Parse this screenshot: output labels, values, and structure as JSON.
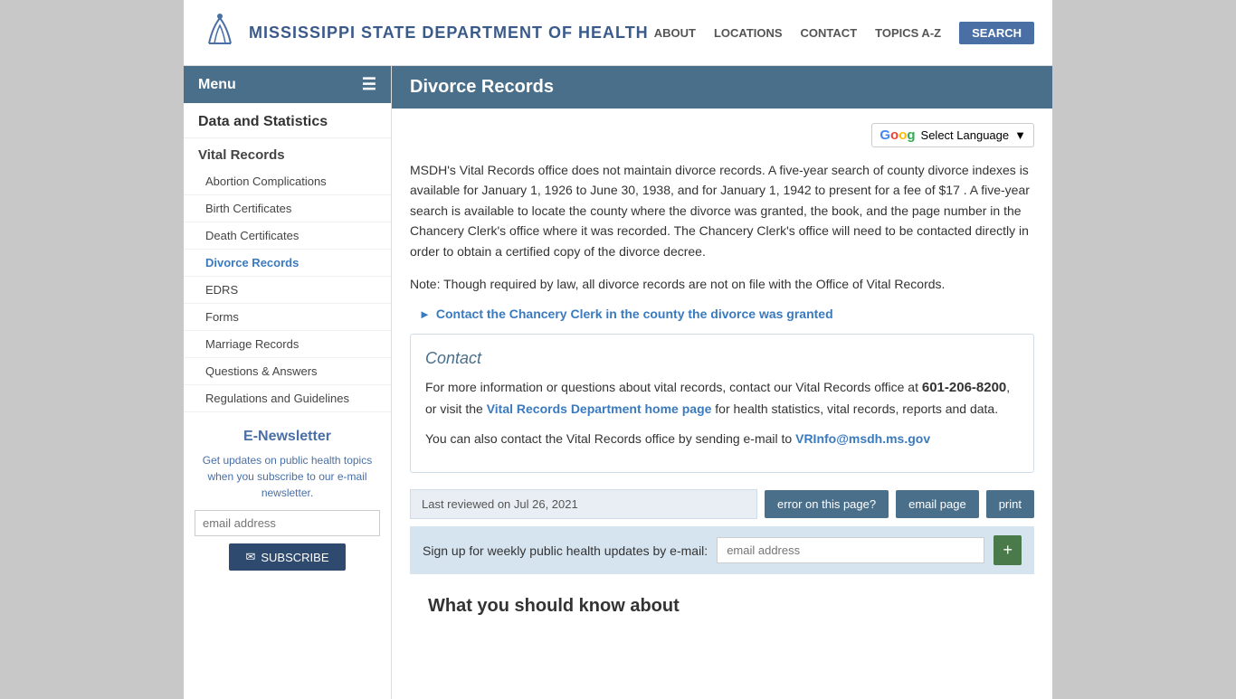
{
  "header": {
    "logo_icon": "🏛",
    "site_title": "Mississippi State Department of Health",
    "nav": {
      "about": "ABOUT",
      "locations": "LOCATIONS",
      "contact": "CONTACT",
      "topics_az": "TOPICS A-Z",
      "search": "SEARCH"
    }
  },
  "sidebar": {
    "menu_label": "Menu",
    "section_title": "Data and Statistics",
    "group_title": "Vital Records",
    "items": [
      {
        "label": "Abortion Complications",
        "active": false
      },
      {
        "label": "Birth Certificates",
        "active": false
      },
      {
        "label": "Death Certificates",
        "active": false
      },
      {
        "label": "Divorce Records",
        "active": true
      },
      {
        "label": "EDRS",
        "active": false
      },
      {
        "label": "Forms",
        "active": false
      },
      {
        "label": "Marriage Records",
        "active": false
      },
      {
        "label": "Questions & Answers",
        "active": false
      },
      {
        "label": "Regulations and Guidelines",
        "active": false
      }
    ],
    "enewsletter": {
      "title": "E-Newsletter",
      "description": "Get updates on public health topics when you subscribe to our e-mail newsletter.",
      "email_placeholder": "email address",
      "subscribe_label": "SUBSCRIBE"
    }
  },
  "content": {
    "page_title": "Divorce Records",
    "translate_label": "Select Language",
    "main_text": "MSDH's Vital Records office does not maintain divorce records. A five-year search of county divorce indexes is available for January 1, 1926 to June 30, 1938, and for January 1, 1942 to present for a fee of $17 . A five-year search is available to locate the county where the divorce was granted, the book, and the page number in the Chancery Clerk's office where it was recorded. The Chancery Clerk's office will need to be contacted directly in order to obtain a certified copy of the divorce decree.",
    "note_text": "Note: Though required by law, all divorce records are not on file with the Office of Vital Records.",
    "chancery_link": "Contact the Chancery Clerk in the county the divorce was granted",
    "contact": {
      "title": "Contact",
      "text1_before": "For more information or questions about vital records, contact our Vital Records office at ",
      "phone": "601-206-8200",
      "text1_after": ", or visit the ",
      "dept_link": "Vital Records Department home page",
      "text1_end": " for health statistics, vital records, reports and data.",
      "text2_before": "You can also contact the Vital Records office by sending e-mail to ",
      "email_link": "VRInfo@msdh.ms.gov"
    },
    "last_reviewed": "Last reviewed on Jul 26, 2021",
    "error_btn": "error on this page?",
    "email_btn": "email page",
    "print_btn": "print",
    "signup_label": "Sign up for weekly public health updates by e-mail:",
    "signup_email_placeholder": "email address",
    "what_know_title": "What you should know about"
  }
}
